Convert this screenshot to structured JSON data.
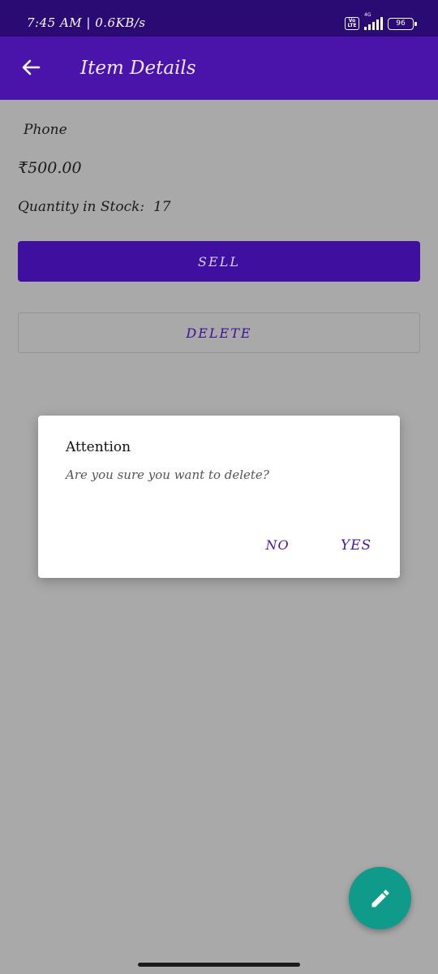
{
  "status_bar": {
    "time_speed": "7:45 AM | 0.6KB/s",
    "volte": "Vo LTE",
    "network": "4G",
    "battery": "96"
  },
  "app_bar": {
    "title": "Item Details",
    "back_icon": "arrow-left-icon"
  },
  "item": {
    "name": "Phone",
    "price": "₹500.00",
    "quantity_label": "Quantity in Stock:",
    "quantity_value": "17"
  },
  "actions": {
    "sell_label": "SELL",
    "delete_label": "DELETE"
  },
  "dialog": {
    "title": "Attention",
    "message": "Are you sure you want to delete?",
    "no_label": "NO",
    "yes_label": "YES"
  },
  "fab": {
    "icon": "edit-pencil-icon"
  },
  "colors": {
    "primary": "#4a13aa",
    "status_bar": "#2a0a73",
    "accent": "#0f9a8a",
    "scrim_background": "#a9a9a9"
  }
}
